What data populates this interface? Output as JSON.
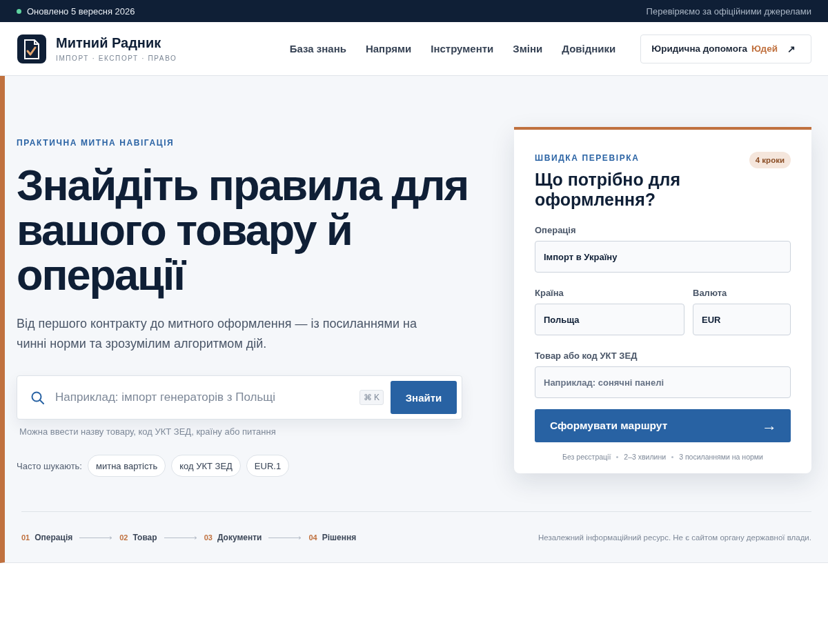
{
  "topbar": {
    "status": "Оновлено 5 вересня 2026",
    "note": "Перевіряємо за офіційними джерелами"
  },
  "header": {
    "brand": "Митний Радник",
    "tagline": "ІМПОРТ · ЕКСПОРТ · ПРАВО",
    "nav": [
      {
        "label": "База знань"
      },
      {
        "label": "Напрями"
      },
      {
        "label": "Інструменти"
      },
      {
        "label": "Зміни"
      },
      {
        "label": "Довідники"
      }
    ],
    "help_button": {
      "label": "Юридична допомога",
      "accent": "Юдей",
      "arrow": "↗"
    }
  },
  "hero": {
    "eyebrow": "ПРАКТИЧНА МИТНА НАВІГАЦІЯ",
    "title": "Знайдіть правила для вашого товару й операції",
    "lead": "Від першого контракту до митного оформлення — із посиланнями на чинні норми та зрозумілим алгоритмом дій.",
    "search": {
      "placeholder": "Наприклад: імпорт генераторів з Польщі",
      "shortcut_symbol": "⌘",
      "shortcut_key": "K",
      "button": "Знайти"
    },
    "hint": "Можна ввести назву товару, код УКТ ЗЕД, країну або питання",
    "popular": {
      "label": "Часто шукають:",
      "tags": [
        "митна вартість",
        "код УКТ ЗЕД",
        "EUR.1"
      ]
    }
  },
  "card": {
    "eyebrow": "ШВИДКА ПЕРЕВІРКА",
    "badge": "4 кроки",
    "title": "Що потрібно для оформлення?",
    "rows": [
      {
        "fields": [
          {
            "label": "Операція",
            "value": "Імпорт в Україну"
          }
        ]
      },
      {
        "fields": [
          {
            "label": "Країна",
            "value": "Польща"
          },
          {
            "label": "Валюта",
            "value": "EUR"
          }
        ]
      },
      {
        "fields": [
          {
            "label": "Товар або код УКТ ЗЕД",
            "placeholder": "Наприклад: сонячні панелі"
          }
        ]
      }
    ],
    "submit": {
      "label": "Сформувати маршрут",
      "arrow": "→"
    },
    "footnotes": [
      "Без реєстрації",
      "2–3 хвилини",
      "3 посиланнями на норми"
    ]
  },
  "steps": [
    {
      "number": "01",
      "label": "Операція"
    },
    {
      "number": "02",
      "label": "Товар"
    },
    {
      "number": "03",
      "label": "Документи"
    },
    {
      "number": "04",
      "label": "Рішення"
    }
  ],
  "disclaimer": "Незалежний інформаційний ресурс. Не є сайтом органу державної влади."
}
